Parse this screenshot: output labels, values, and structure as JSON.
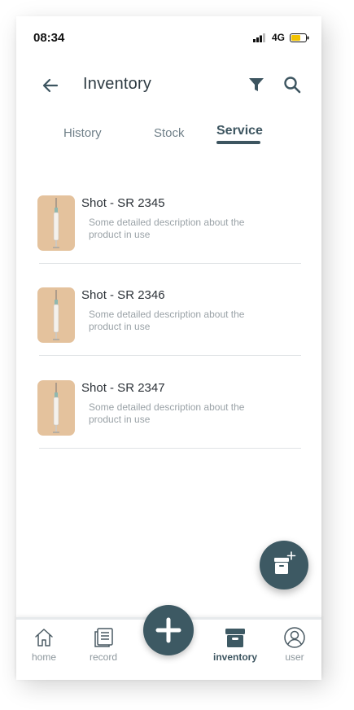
{
  "status_bar": {
    "time": "08:34",
    "network": "4G",
    "battery_color": "#f2c200"
  },
  "header": {
    "title": "Inventory",
    "back_icon": "back-arrow-icon",
    "filter_icon": "filter-icon",
    "search_icon": "search-icon"
  },
  "tabs": [
    {
      "label": "History",
      "active": false
    },
    {
      "label": "Stock",
      "active": false
    },
    {
      "label": "Service",
      "active": true
    }
  ],
  "items": [
    {
      "title": "Shot - SR 2345",
      "description": "Some detailed description about the product in use",
      "thumbnail": "syringe-image"
    },
    {
      "title": "Shot - SR 2346",
      "description": "Some detailed description about the product in use",
      "thumbnail": "syringe-image"
    },
    {
      "title": "Shot - SR 2347",
      "description": "Some detailed description about the product in use",
      "thumbnail": "syringe-image"
    }
  ],
  "fab": {
    "icon": "add-archive-icon"
  },
  "nav": {
    "items": [
      {
        "label": "home",
        "icon": "home-icon",
        "active": false
      },
      {
        "label": "record",
        "icon": "record-icon",
        "active": false
      },
      {
        "label": "inventory",
        "icon": "archive-icon",
        "active": true
      },
      {
        "label": "user",
        "icon": "user-icon",
        "active": false
      }
    ],
    "center_icon": "plus-icon"
  },
  "colors": {
    "primary": "#3d5963",
    "thumbnail_bg": "#e4c29d",
    "text": "#2e3b43",
    "muted": "#9aa2a7"
  }
}
